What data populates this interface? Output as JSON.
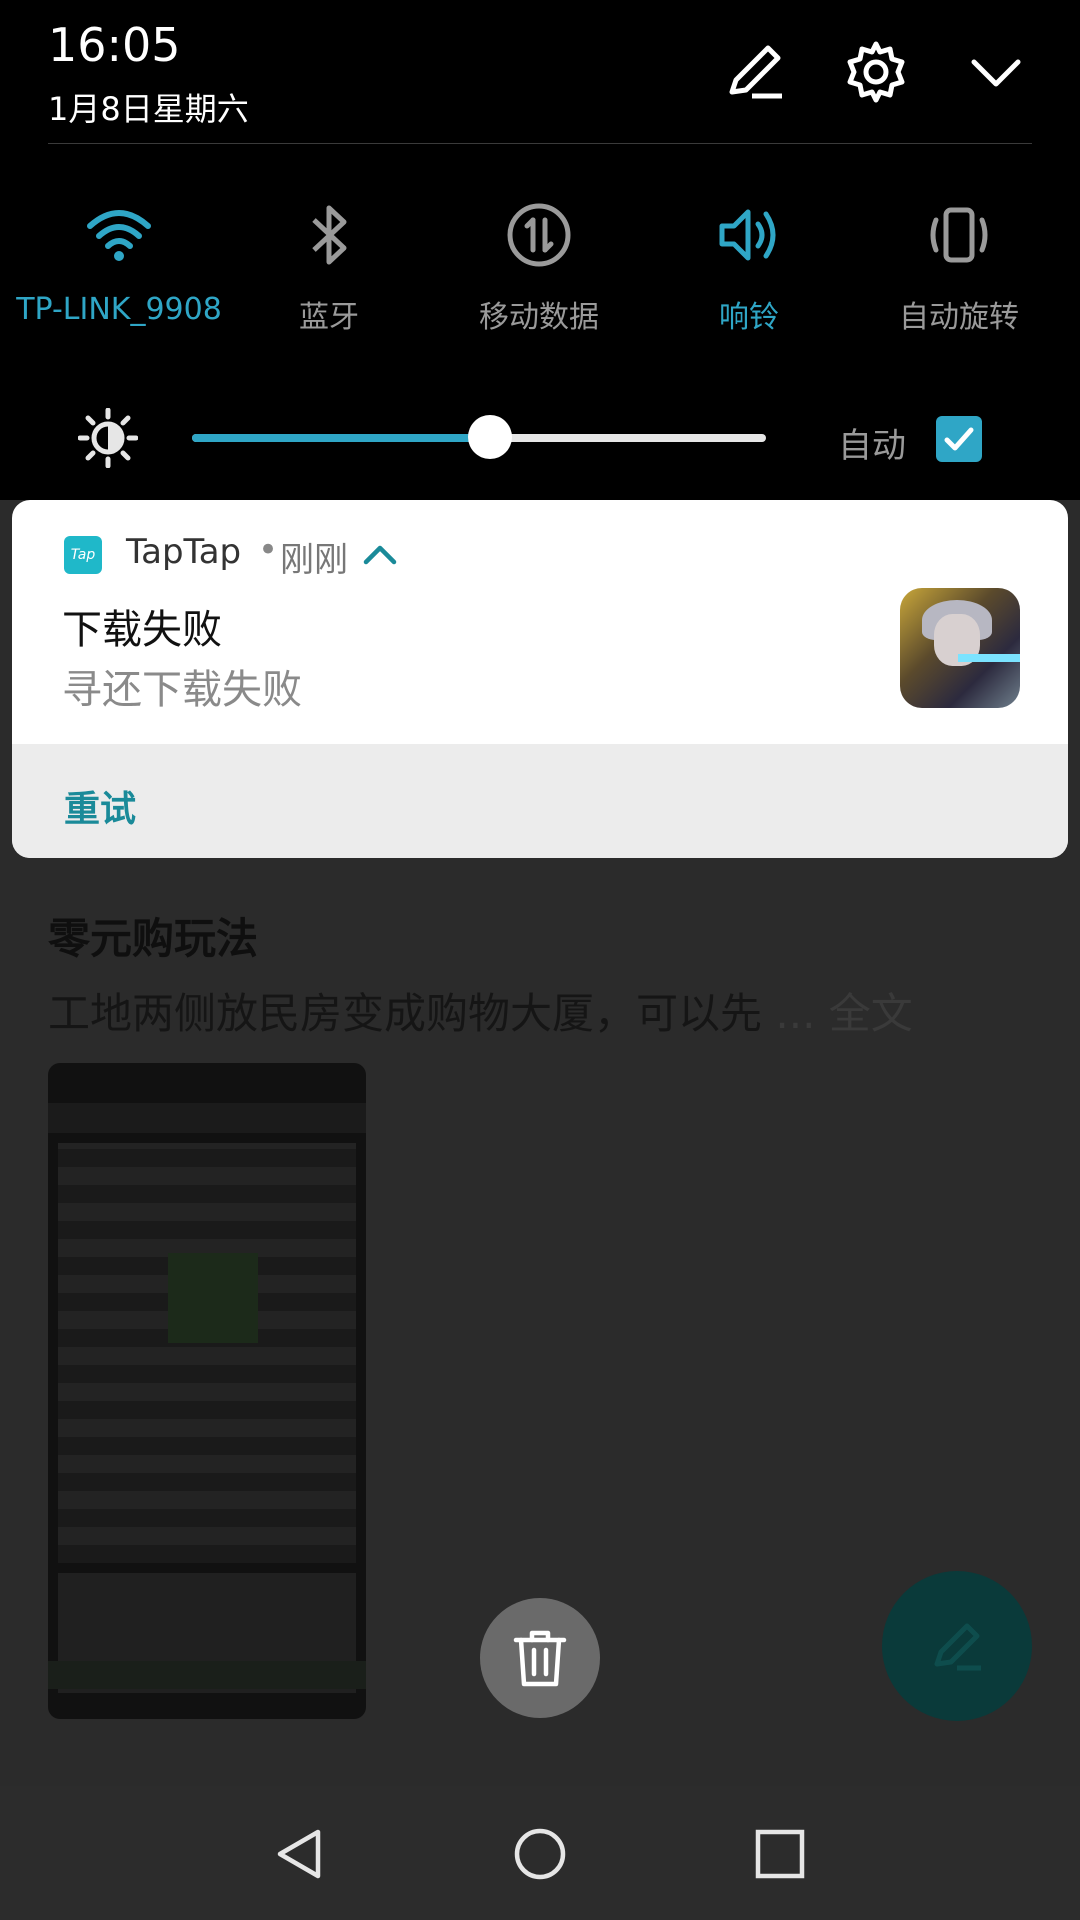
{
  "status": {
    "time": "16:05",
    "date": "1月8日星期六"
  },
  "header_icons": [
    "edit-icon",
    "settings-icon",
    "collapse-chevron-icon"
  ],
  "quick_settings": [
    {
      "key": "wifi",
      "label": "TP-LINK_9908",
      "icon": "wifi-icon",
      "active": true
    },
    {
      "key": "bluetooth",
      "label": "蓝牙",
      "icon": "bluetooth-icon",
      "active": false
    },
    {
      "key": "mobile_data",
      "label": "移动数据",
      "icon": "mobile-data-icon",
      "active": false
    },
    {
      "key": "ring",
      "label": "响铃",
      "icon": "speaker-icon",
      "active": true
    },
    {
      "key": "rotate",
      "label": "自动旋转",
      "icon": "auto-rotate-icon",
      "active": false
    }
  ],
  "brightness": {
    "level": 0.52,
    "auto_label": "自动",
    "auto_checked": true
  },
  "notification": {
    "app_icon_text": "Tap",
    "app_name": "TapTap",
    "separator": "•",
    "when": "刚刚",
    "title": "下载失败",
    "body": "寻还下载失败",
    "action": "重试"
  },
  "background_app": {
    "post_title": "零元购玩法",
    "post_body": "工地两侧放民房变成购物大厦，可以先",
    "more_ellipsis": "...",
    "more_label": "全文"
  },
  "colors": {
    "accent": "#2fa6c6",
    "action": "#1a8a99",
    "shade_bg": "#000000",
    "card_bg": "#ffffff"
  }
}
